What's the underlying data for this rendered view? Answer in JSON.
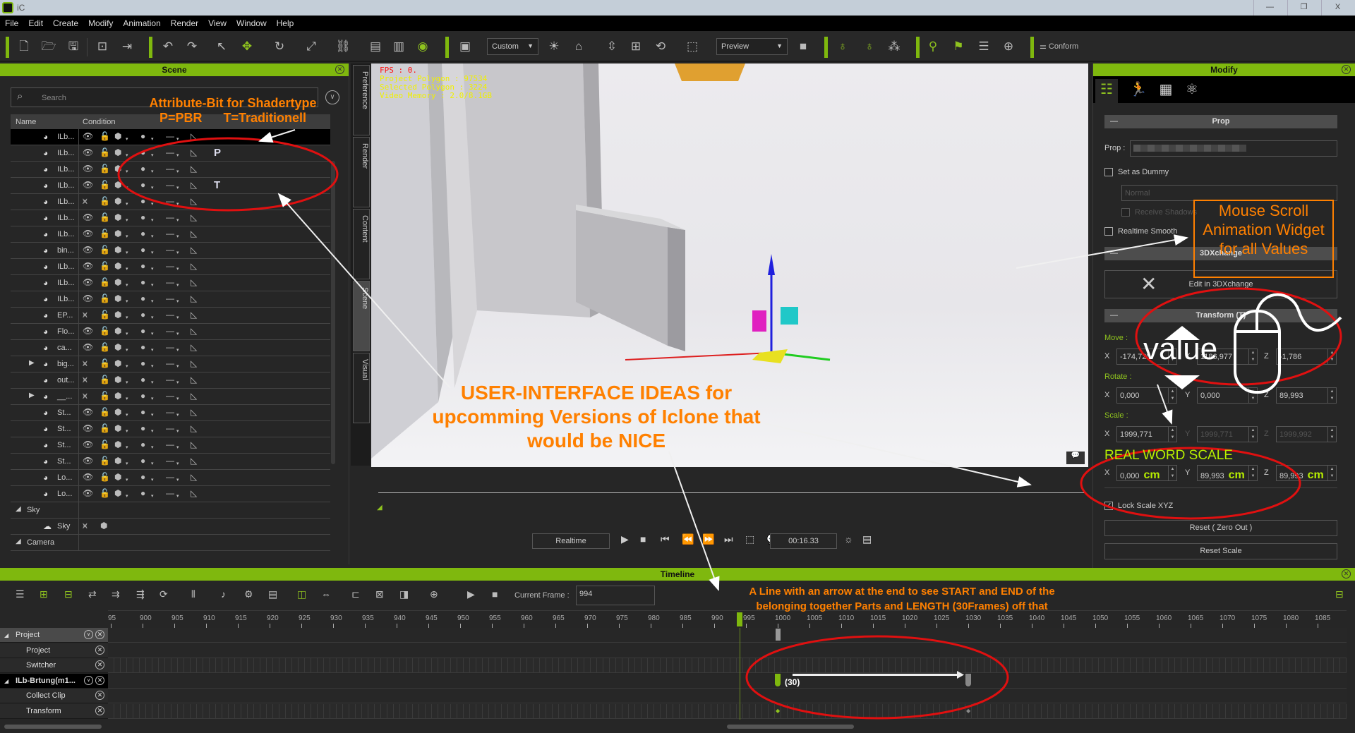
{
  "window": {
    "title": "iC",
    "controls": [
      "—",
      "❐",
      "X"
    ]
  },
  "menu": [
    "File",
    "Edit",
    "Create",
    "Modify",
    "Animation",
    "Render",
    "View",
    "Window",
    "Help"
  ],
  "toolbar": {
    "view_dropdown": "Custom",
    "render_dropdown": "Preview",
    "conform_label": "Conform"
  },
  "scene": {
    "title": "Scene",
    "search_placeholder": "Search",
    "columns": [
      "Name",
      "Condition"
    ],
    "rows": [
      {
        "name": "ILb...",
        "visible": true,
        "selected": true
      },
      {
        "name": "ILb...",
        "visible": true,
        "shader": "P"
      },
      {
        "name": "ILb...",
        "visible": true
      },
      {
        "name": "ILb...",
        "visible": true,
        "shader": "T"
      },
      {
        "name": "ILb...",
        "visible": false
      },
      {
        "name": "ILb...",
        "visible": true
      },
      {
        "name": "ILb...",
        "visible": true
      },
      {
        "name": "bin...",
        "visible": true
      },
      {
        "name": "ILb...",
        "visible": true
      },
      {
        "name": "ILb...",
        "visible": true
      },
      {
        "name": "ILb...",
        "visible": true
      },
      {
        "name": "EP...",
        "visible": false
      },
      {
        "name": "Flo...",
        "visible": true
      },
      {
        "name": "ca...",
        "visible": true
      },
      {
        "name": "big...",
        "visible": false,
        "expandable": true
      },
      {
        "name": "out...",
        "visible": false
      },
      {
        "name": "__...",
        "visible": false,
        "expandable": true
      },
      {
        "name": "St...",
        "visible": true
      },
      {
        "name": "St...",
        "visible": true
      },
      {
        "name": "St...",
        "visible": true
      },
      {
        "name": "St...",
        "visible": true
      },
      {
        "name": "Lo...",
        "visible": true
      },
      {
        "name": "Lo...",
        "visible": true
      }
    ],
    "groups": {
      "sky": "Sky",
      "sky_item": "Sky",
      "camera": "Camera"
    }
  },
  "side_tabs": [
    "Preference",
    "Render",
    "Content",
    "Scene",
    "Visual"
  ],
  "active_side_tab": "Scene",
  "viewport": {
    "fps": "FPS : 0.",
    "project_polygon": "Project Polygon : 97534",
    "selected_polygon": "Selected Polygon : 3224",
    "video_memory": "Video Memory : 2.0/8.1GB"
  },
  "playback": {
    "mode": "Realtime",
    "time": "00:16.33"
  },
  "modify": {
    "title": "Modify",
    "prop_section": "Prop",
    "prop_label": "Prop :",
    "set_as_dummy": "Set as Dummy",
    "normal": "Normal",
    "receive_shadows": "Receive Shadows",
    "realtime_smooth": "Realtime Smooth",
    "xchange_section": "3DXchange",
    "edit_in_3dxchange": "Edit in 3DXchange",
    "transform_section": "Transform (T)",
    "move_label": "Move :",
    "rotate_label": "Rotate :",
    "scale_label": "Scale :",
    "move": {
      "x": "-174,720",
      "y": "1186,977",
      "z": "-1,786"
    },
    "rotate": {
      "x": "0,000",
      "y": "0,000",
      "z": "89,993"
    },
    "scale": {
      "x": "1999,771",
      "y": "1999,771",
      "z": "1999,992"
    },
    "real_scale": {
      "x": "0,000",
      "y": "89,993",
      "z": "89,993",
      "unit": "cm"
    },
    "axis": {
      "x": "X",
      "y": "Y",
      "z": "Z"
    },
    "lock_scale": "Lock Scale XYZ",
    "lock_scale_checked": true,
    "reset_zero": "Reset ( Zero Out )",
    "reset_scale": "Reset Scale"
  },
  "timeline": {
    "title": "Timeline",
    "current_frame_label": "Current Frame :",
    "current_frame": "994",
    "ruler": [
      "95",
      "900",
      "905",
      "910",
      "915",
      "920",
      "925",
      "930",
      "935",
      "940",
      "945",
      "950",
      "955",
      "960",
      "965",
      "970",
      "975",
      "980",
      "985",
      "990",
      "995",
      "1000",
      "1005",
      "1010",
      "1015",
      "1020",
      "1025",
      "1030",
      "1035",
      "1040",
      "1045",
      "1050",
      "1055",
      "1060",
      "1065",
      "1070",
      "1075",
      "1080",
      "1085"
    ],
    "tracks": [
      {
        "label": "Project",
        "group": true
      },
      {
        "label": "Project"
      },
      {
        "label": "Switcher"
      },
      {
        "label": "ILb-Brtung(m1...",
        "group": true,
        "selected": true
      },
      {
        "label": "Collect Clip"
      },
      {
        "label": "Transform"
      }
    ],
    "clip": {
      "start": 1000,
      "end": 1030,
      "length_label": "(30)"
    }
  },
  "annotations": {
    "shader_title": "Attribute-Bit for Shadertype",
    "shader_legend": "P=PBR      T=Traditionell",
    "mouse_scroll": "Mouse Scroll Animation Widget for all Values",
    "value_word": "value",
    "real_scale": "REAL WORD SCALE",
    "main_line1": "USER-INTERFACE IDEAS for",
    "main_line2": "upcomming Versions of Iclone that",
    "main_line3": "would be NICE",
    "line_arrow_1": "A Line with an arrow at the end to  see START and END of the",
    "line_arrow_2": "belonging together Parts and LENGTH (30Frames) off that",
    "colors": {
      "annotation": "#ff8000",
      "circle": "#e01010",
      "accent": "#7fb80e"
    }
  }
}
